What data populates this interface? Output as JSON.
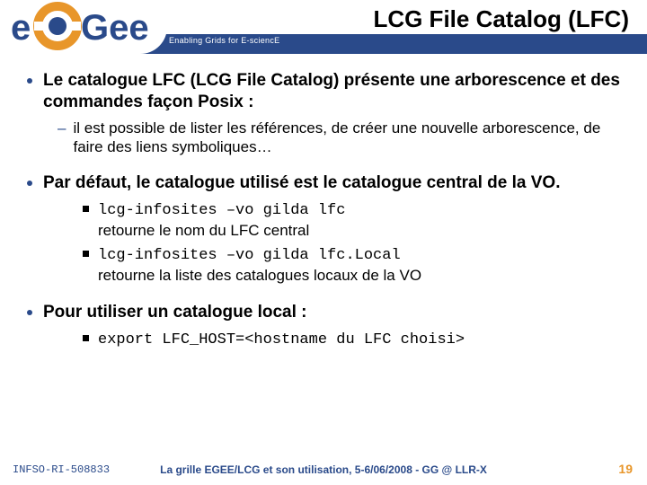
{
  "header": {
    "title": "LCG File Catalog (LFC)",
    "tagline": "Enabling Grids for E-sciencE",
    "logo_text_e": "e",
    "logo_text_gee": "Gee"
  },
  "bullets": [
    {
      "text": "Le catalogue LFC (LCG File Catalog) présente une arborescence et des commandes façon Posix :",
      "sub": [
        {
          "text": "il est possible de lister les références, de créer une nouvelle arborescence, de faire des liens symboliques…"
        }
      ]
    },
    {
      "text": "Par défaut, le catalogue utilisé est le catalogue central de la VO.",
      "sub3": [
        {
          "code": "lcg-infosites –vo gilda lfc",
          "desc": "retourne le nom du LFC central"
        },
        {
          "code": "lcg-infosites –vo gilda lfc.Local",
          "desc": "retourne la liste des catalogues locaux de la VO"
        }
      ]
    },
    {
      "text": "Pour utiliser un catalogue local :",
      "sub3": [
        {
          "code": "export LFC_HOST=<hostname du LFC choisi>"
        }
      ]
    }
  ],
  "footer": {
    "left": "INFSO-RI-508833",
    "center": "La grille EGEE/LCG et son utilisation, 5-6/06/2008 - GG @ LLR-X",
    "right": "19"
  }
}
